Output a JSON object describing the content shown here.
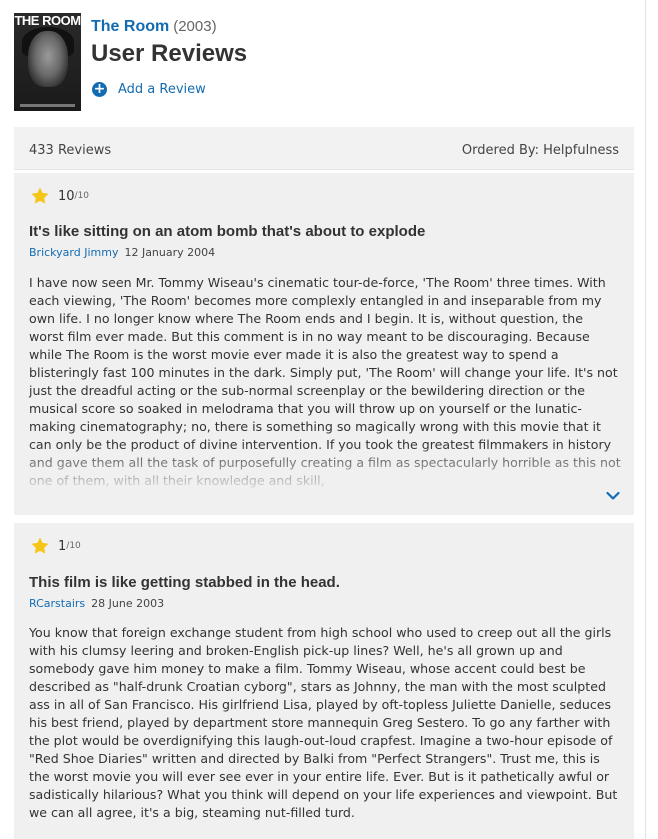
{
  "header": {
    "poster_title": "THE ROOM",
    "movie_title": "The Room",
    "movie_year": "(2003)",
    "page_title": "User Reviews",
    "add_review_label": "Add a Review"
  },
  "list_header": {
    "count": "433 Reviews",
    "ordered_by": "Ordered By: Helpfulness"
  },
  "colors": {
    "link": "#136cb2",
    "star": "#f5c518",
    "panel": "#f0f0f0"
  },
  "icons": [
    "plus-icon",
    "star-icon",
    "chevron-down-icon"
  ],
  "reviews": [
    {
      "rating": "10",
      "scale": "/10",
      "title": "It's like sitting on an atom bomb that's about to explode",
      "author": "Brickyard Jimmy",
      "date": "12 January 2004",
      "text": "I have now seen Mr. Tommy Wiseau's cinematic tour-de-force, 'The Room' three times. With each viewing, 'The Room' becomes more complexly entangled in and inseparable from my own life. I no longer know where The Room ends and I begin. It is, without question, the worst film ever made. But this comment is in no way meant to be discouraging. Because while The Room is the worst movie ever made it is also the greatest way to spend a blisteringly fast 100 minutes in the dark. Simply put, 'The Room' will change your life. It's not just the dreadful acting or the sub-normal screenplay or the bewildering direction or the musical score so soaked in melodrama that you will throw up on yourself or the lunatic-making cinematography; no, there is something so magically wrong with this movie that it can only be the product of divine intervention. If you took the greatest filmmakers in history and gave them all the task of purposefully creating a film as spectacularly horrible as this not one of them, with all their knowledge and skill,"
    },
    {
      "rating": "1",
      "scale": "/10",
      "title": "This film is like getting stabbed in the head.",
      "author": "RCarstairs",
      "date": "28 June 2003",
      "text": "You know that foreign exchange student from high school who used to creep out all the girls with his clumsy leering and broken-English pick-up lines? Well, he's all grown up and somebody gave him money to make a film. Tommy Wiseau, whose accent could best be described as \"half-drunk Croatian cyborg\", stars as Johnny, the man with the most sculpted ass in all of San Francisco. His girlfriend Lisa, played by oft-topless Juliette Danielle, seduces his best friend, played by department store mannequin Greg Sestero. To go any farther with the plot would be overdignifying this laugh-out-loud crapfest. Imagine a two-hour episode of \"Red Shoe Diaries\" written and directed by Balki from \"Perfect Strangers\". Trust me, this is the worst movie you will ever see ever in your entire life. Ever. But is it pathetically awful or sadistically hilarious? What you think will depend on your life experiences and viewpoint. But we can all agree, it's a big, steaming nut-filled turd."
    }
  ]
}
